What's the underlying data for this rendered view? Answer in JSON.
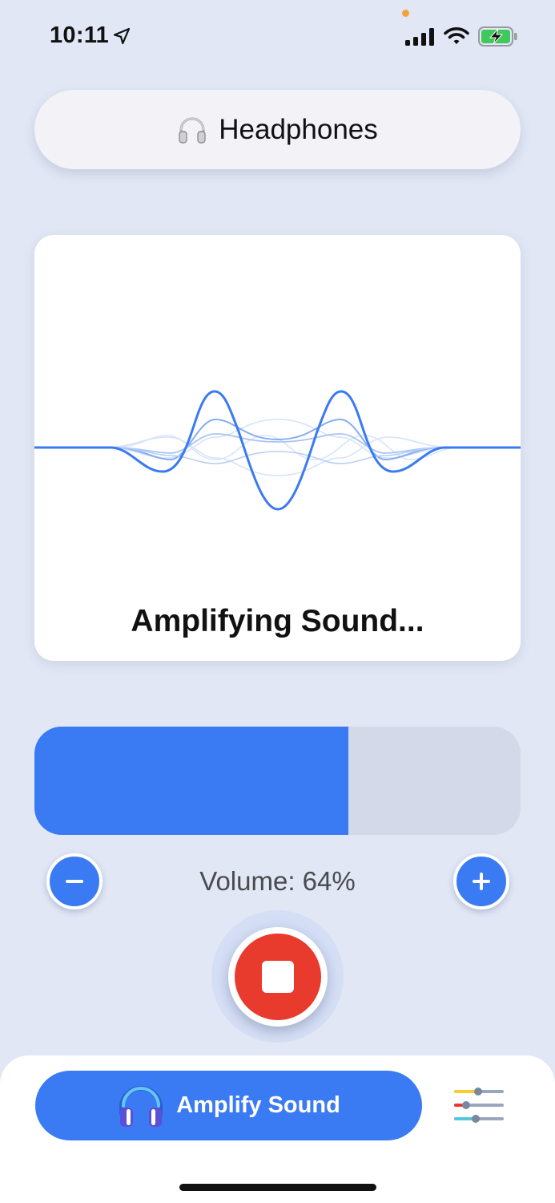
{
  "status_bar": {
    "time": "10:11",
    "icons": [
      "location-arrow-icon",
      "signal-icon",
      "wifi-icon",
      "battery-charging-icon"
    ],
    "privacy_indicator_color": "#f5a23a"
  },
  "device": {
    "label": "Headphones",
    "icon": "headphones-icon"
  },
  "waveform_card": {
    "status_text": "Amplifying Sound..."
  },
  "volume": {
    "label": "Volume: 64%",
    "fraction": 0.645,
    "fill_color": "#3a7af2",
    "track_color": "#d3d9e8",
    "decrease_icon": "minus-icon",
    "increase_icon": "plus-icon"
  },
  "stop_button": {
    "icon": "stop-icon",
    "color": "#e93a2e"
  },
  "bottom_bar": {
    "amplify_label": "Amplify Sound",
    "amplify_icon": "headphones-icon",
    "settings_icon": "sliders-icon"
  },
  "colors": {
    "background": "#e1e7f5",
    "accent": "#3a7af2"
  }
}
